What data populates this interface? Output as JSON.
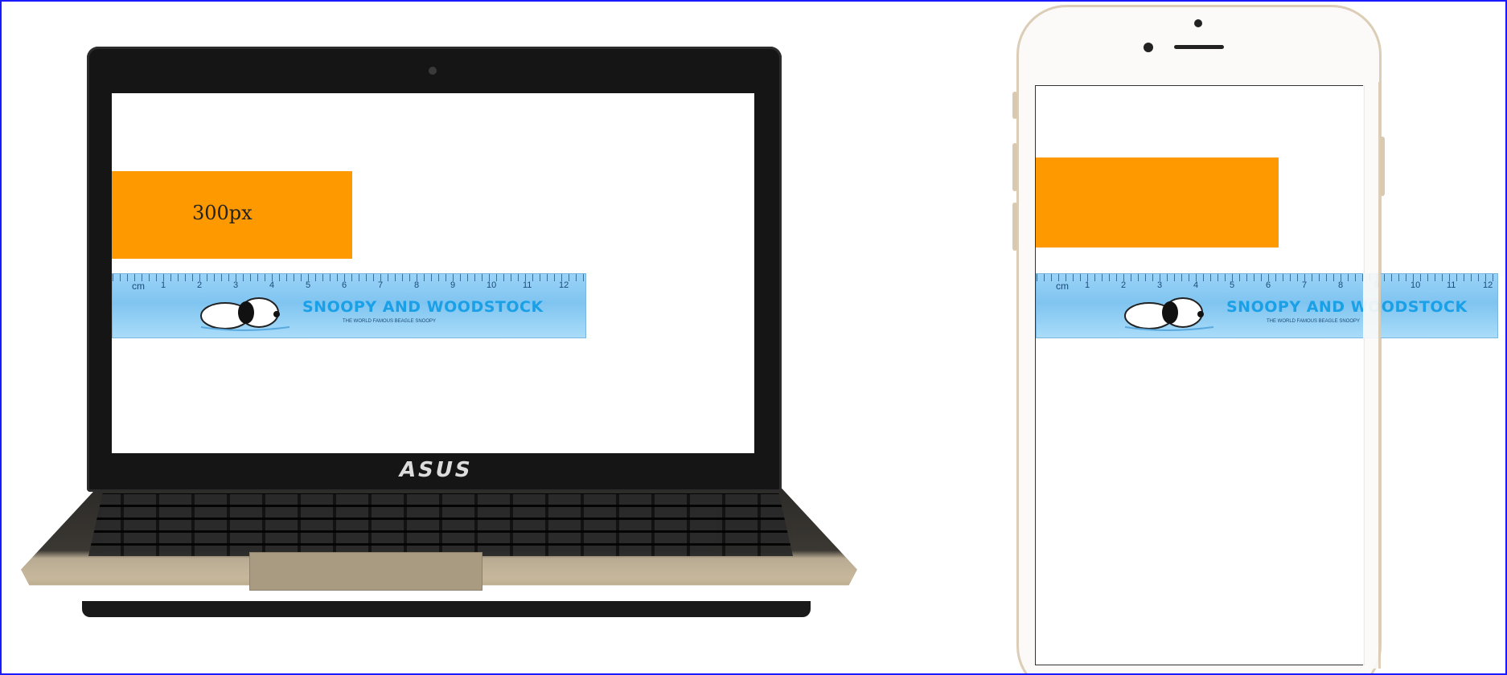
{
  "laptop": {
    "brand_logo": "ASUS",
    "orange_block": {
      "label": "300px",
      "color": "#ff9900"
    }
  },
  "phone": {
    "orange_block": {
      "color": "#ff9900"
    }
  },
  "ruler": {
    "unit": "cm",
    "numbers": [
      "1",
      "2",
      "3",
      "4",
      "5",
      "6",
      "7",
      "8",
      "9",
      "10",
      "11",
      "12"
    ],
    "title": "SNOOPY AND WOODSTOCK",
    "subtitle": "THE WORLD FAMOUS BEAGLE SNOOPY"
  },
  "colors": {
    "frame_border": "#1a1aff",
    "orange": "#ff9900",
    "ruler_blue": "#8fcdf4",
    "ruler_text": "#1aa0e6"
  }
}
